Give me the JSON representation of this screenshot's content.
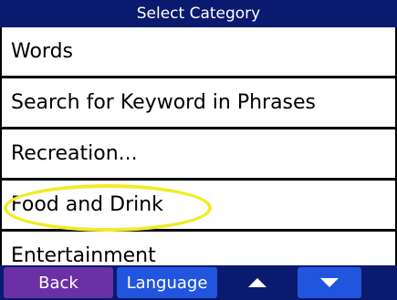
{
  "title": "Select Category",
  "categories": [
    "Words",
    "Search for Keyword in Phrases",
    "Recreation...",
    "Food and Drink",
    "Entertainment"
  ],
  "buttons": {
    "back": "Back",
    "language": "Language"
  },
  "icons": {
    "up": "up-arrow-icon",
    "down": "down-arrow-icon"
  },
  "colors": {
    "bar": "#0a1a6e",
    "back": "#6b2fa6",
    "accent": "#2255dd",
    "highlight_circle": "#f2ea2a"
  }
}
